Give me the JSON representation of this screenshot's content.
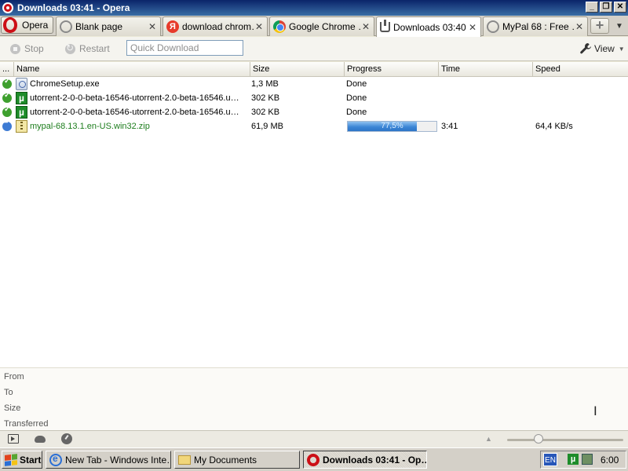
{
  "window": {
    "title": "Downloads 03:41 - Opera",
    "buttons": {
      "minimize": "_",
      "restore": "❐",
      "close": "✕"
    }
  },
  "tabbar": {
    "menu_label": "Opera",
    "tabs": [
      {
        "label": "Blank page",
        "icon": "loading-ring-icon",
        "active": false
      },
      {
        "label": "download chrom…",
        "icon": "yandex-icon",
        "active": false
      },
      {
        "label": "Google Chrome …",
        "icon": "chrome-icon",
        "active": false
      },
      {
        "label": "Downloads 03:40",
        "icon": "download-icon",
        "active": true
      },
      {
        "label": "MyPal 68 : Free …",
        "icon": "loading-ring-icon",
        "active": false
      }
    ],
    "close_glyph": "✕",
    "new_tab_glyph": "+",
    "menu_glyph": "▼"
  },
  "toolbar": {
    "stop_label": "Stop",
    "restart_label": "Restart",
    "quick_download_placeholder": "Quick Download",
    "view_label": "View"
  },
  "table": {
    "columns": {
      "status": "...",
      "name": "Name",
      "size": "Size",
      "progress": "Progress",
      "time": "Time",
      "speed": "Speed"
    },
    "rows": [
      {
        "status": "done",
        "file_icon": "exe-file-icon",
        "name": "ChromeSetup.exe",
        "size": "1,3 MB",
        "progress": "Done",
        "time": "",
        "speed": ""
      },
      {
        "status": "done",
        "file_icon": "utorrent-file-icon",
        "name": "utorrent-2-0-0-beta-16546-utorrent-2.0-beta-16546.u…",
        "size": "302 KB",
        "progress": "Done",
        "time": "",
        "speed": ""
      },
      {
        "status": "done",
        "file_icon": "utorrent-file-icon",
        "name": "utorrent-2-0-0-beta-16546-utorrent-2.0-beta-16546.u…",
        "size": "302 KB",
        "progress": "Done",
        "time": "",
        "speed": ""
      },
      {
        "status": "downloading",
        "file_icon": "zip-file-icon",
        "name": "mypal-68.13.1.en-US.win32.zip",
        "size": "61,9 MB",
        "progress_label": "77,5%",
        "progress_fraction": 0.775,
        "time": "3:41",
        "speed": "64,4 KB/s"
      }
    ]
  },
  "details": {
    "from_label": "From",
    "to_label": "To",
    "size_label": "Size",
    "transferred_label": "Transferred"
  },
  "statusbar": {
    "zoom_fraction": 0.27
  },
  "taskbar": {
    "start_label": "Start",
    "items": [
      {
        "label": "New Tab - Windows Inte…",
        "icon": "internet-explorer-icon",
        "pressed": false
      },
      {
        "label": "My Documents",
        "icon": "folder-icon",
        "pressed": false
      },
      {
        "label": "Downloads 03:41 - Op…",
        "icon": "opera-icon",
        "pressed": true
      }
    ],
    "language": "EN",
    "clock": "6:00"
  },
  "colors": {
    "title_bar": "#0a246a",
    "opera_red": "#cc0f16",
    "done_green": "#3ea02e",
    "active_file_green": "#1c7d1c",
    "progress_blue": "#3d86d6"
  }
}
